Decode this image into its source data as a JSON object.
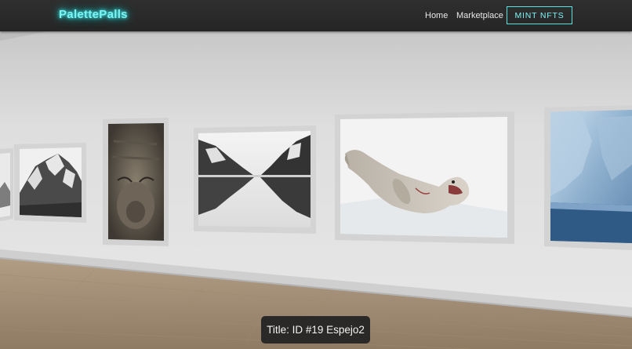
{
  "brand": {
    "name": "PalettePalls"
  },
  "nav": {
    "home": "Home",
    "marketplace": "Marketplace",
    "mint": "MINT NFTS"
  },
  "gallery": {
    "paintings": [
      {
        "subject": "snowy-mountain-edge"
      },
      {
        "subject": "snowy-mountain"
      },
      {
        "subject": "elephant-seal-face"
      },
      {
        "subject": "fjord-reflection"
      },
      {
        "subject": "crabeater-seal-on-ice"
      },
      {
        "subject": "iceberg"
      }
    ],
    "tooltip": "Title: ID #19 Espejo2"
  }
}
